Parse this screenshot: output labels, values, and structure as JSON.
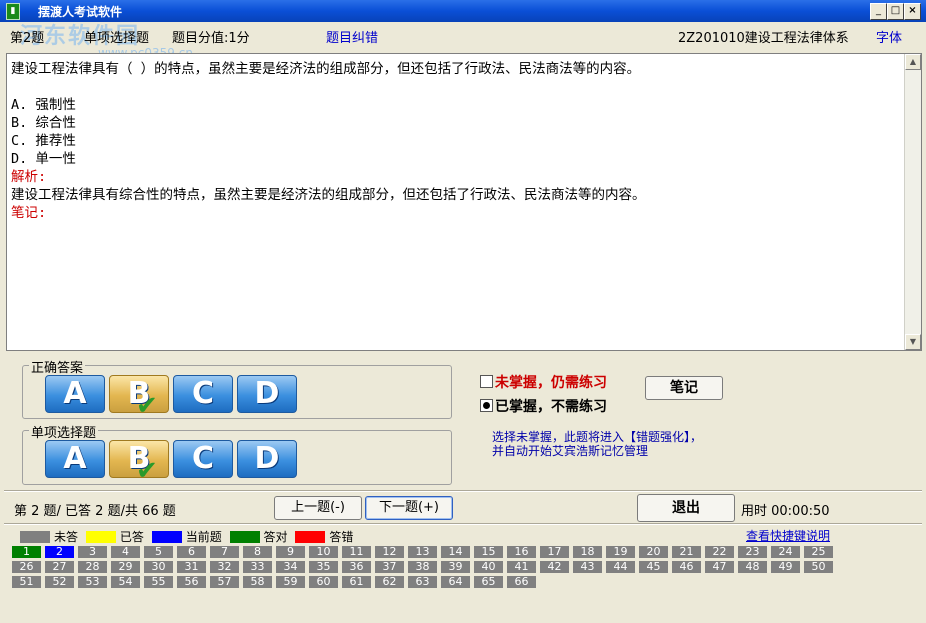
{
  "window": {
    "title": "摆渡人考试软件",
    "watermark": "河东软件园",
    "watermark_url": "www.pc0359.cn"
  },
  "infobar": {
    "question_no": "第2题",
    "question_type": "单项选择题",
    "score": "题目分值:1分",
    "report_error": "题目纠错",
    "category": "2Z201010建设工程法律体系",
    "font_button": "字体"
  },
  "question": {
    "stem": "建设工程法律具有（ ）的特点，虽然主要是经济法的组成部分，但还包括了行政法、民法商法等的内容。",
    "options": [
      "A. 强制性",
      "B. 综合性",
      "C. 推荐性",
      "D. 单一性"
    ],
    "analysis_label": "解析:",
    "analysis": "建设工程法律具有综合性的特点，虽然主要是经济法的组成部分，但还包括了行政法、民法商法等的内容。",
    "note_label": "笔记:"
  },
  "correct_answer": {
    "label": "正确答案",
    "letters": [
      "A",
      "B",
      "C",
      "D"
    ],
    "selected": "B"
  },
  "single_choice": {
    "label": "单项选择题",
    "letters": [
      "A",
      "B",
      "C",
      "D"
    ],
    "selected": "B"
  },
  "mastery": {
    "not_mastered": "未掌握，仍需练习",
    "mastered": "已掌握，不需练习",
    "selected": "mastered",
    "note_button": "笔记",
    "hint_line1": "选择未掌握，此题将进入【错题强化】，",
    "hint_line2": "并自动开始艾宾浩斯记忆管理"
  },
  "statusbar": {
    "progress": "第 2 题/ 已答 2 题/共 66 题",
    "prev_button": "上一题(-)",
    "next_button": "下一题(+)",
    "exit_button": "退出",
    "timer": "用时 00:00:50"
  },
  "legend": {
    "items": [
      {
        "label": "未答",
        "color": "#808080"
      },
      {
        "label": "已答",
        "color": "#ffff00"
      },
      {
        "label": "当前题",
        "color": "#0000ff"
      },
      {
        "label": "答对",
        "color": "#008000"
      },
      {
        "label": "答错",
        "color": "#ff0000"
      }
    ],
    "shortcut_link": "查看快捷键说明"
  },
  "question_grid": {
    "total": 66,
    "per_row": 25,
    "answered_right": [
      1
    ],
    "current": 2
  }
}
